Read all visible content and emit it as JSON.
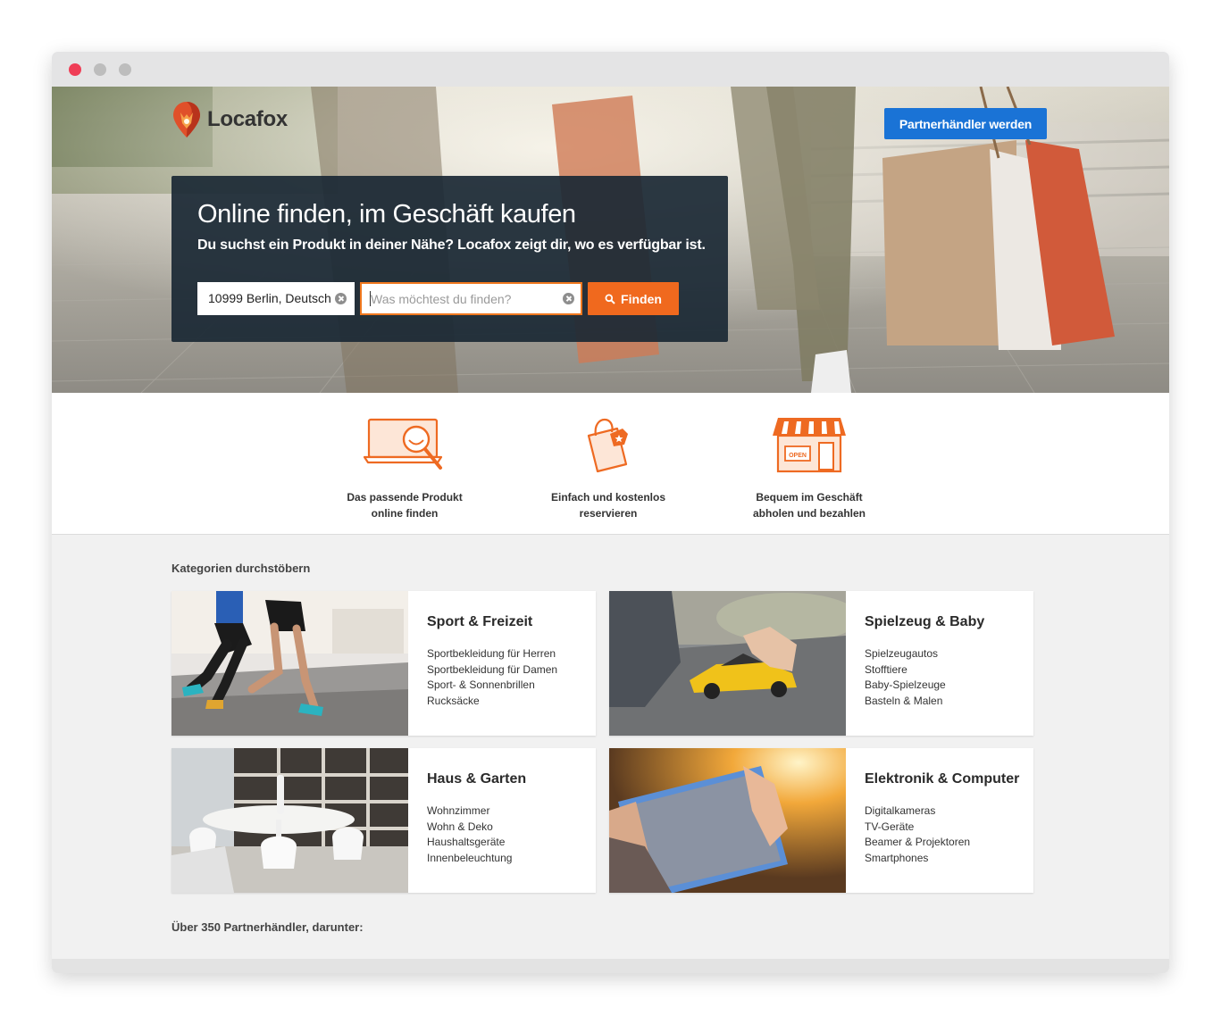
{
  "brand": {
    "name": "Locafox"
  },
  "header": {
    "partner_button": "Partnerhändler werden"
  },
  "hero": {
    "title": "Online finden, im Geschäft kaufen",
    "subtitle": "Du suchst ein Produkt in deiner Nähe? Locafox zeigt dir, wo es verfügbar ist.",
    "location_value": "10999 Berlin, Deutsch",
    "search_placeholder": "Was möchtest du finden?",
    "find_button": "Finden"
  },
  "features": [
    {
      "line1": "Das passende Produkt",
      "line2": "online finden",
      "icon": "laptop-search-icon"
    },
    {
      "line1": "Einfach und kostenlos",
      "line2": "reservieren",
      "icon": "shopping-bag-icon"
    },
    {
      "line1": "Bequem im Geschäft",
      "line2": "abholen und bezahlen",
      "icon": "storefront-icon"
    }
  ],
  "categories_title": "Kategorien durchstöbern",
  "categories": [
    {
      "title": "Sport & Freizeit",
      "items": [
        "Sportbekleidung für Herren",
        "Sportbekleidung für Damen",
        "Sport- & Sonnenbrillen",
        "Rucksäcke"
      ]
    },
    {
      "title": "Spielzeug & Baby",
      "items": [
        "Spielzeugautos",
        "Stofftiere",
        "Baby-Spielzeuge",
        "Basteln & Malen"
      ]
    },
    {
      "title": "Haus & Garten",
      "items": [
        "Wohnzimmer",
        "Wohn & Deko",
        "Haushaltsgeräte",
        "Innenbeleuchtung"
      ]
    },
    {
      "title": "Elektronik & Computer",
      "items": [
        "Digitalkameras",
        "TV-Geräte",
        "Beamer & Projektoren",
        "Smartphones"
      ]
    }
  ],
  "partners_title": "Über 350 Partnerhändler, darunter:",
  "colors": {
    "accent_orange": "#f0691e",
    "partner_blue": "#1a73d6",
    "card_dark": "#1a2834"
  }
}
